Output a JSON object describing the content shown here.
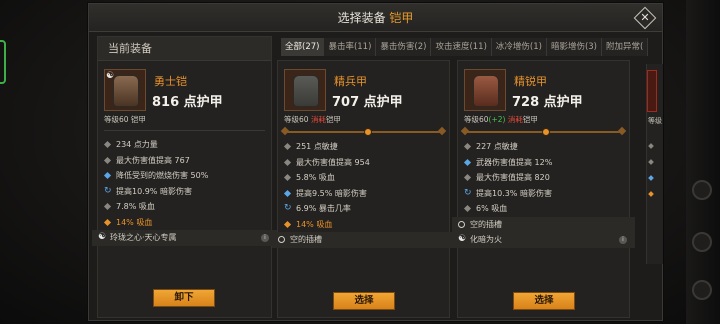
{
  "header": {
    "title_prefix": "选择装备",
    "title_highlight": "铠甲"
  },
  "current": {
    "section_title": "当前装备",
    "item": {
      "name": "勇士铠",
      "armor": "816 点护甲",
      "level_text": "等级60 铠甲",
      "stats": [
        {
          "icon": "diamond-gray",
          "text": "234 点力量"
        },
        {
          "icon": "diamond-gray",
          "text": "最大伤害值提高 767"
        },
        {
          "icon": "diamond-blue",
          "text": "降低受到的燃烧伤害 50%"
        },
        {
          "icon": "cycle-blue",
          "text": "提高10.9% 暗影伤害"
        },
        {
          "icon": "diamond-gray",
          "text": "7.8% 吸血"
        },
        {
          "icon": "diamond-orange",
          "text": "14% 吸血"
        }
      ],
      "socket": {
        "icon": "yin-yang",
        "text": "玲珑之心·天心专属"
      },
      "button": "卸下"
    }
  },
  "tabs": [
    "全部(27)",
    "暴击率(11)",
    "暴击伤害(2)",
    "攻击速度(11)",
    "冰冷增伤(1)",
    "暗影增伤(3)",
    "附加异常("
  ],
  "candidates": [
    {
      "name": "精兵甲",
      "armor": "707 点护甲",
      "level_prefix": "等级60",
      "level_red": "消耗",
      "level_suffix": "铠甲",
      "stats": [
        {
          "icon": "diamond-gray",
          "text": "251 点敏捷"
        },
        {
          "icon": "diamond-gray",
          "text": "最大伤害值提高 954"
        },
        {
          "icon": "diamond-gray",
          "text": "5.8% 吸血"
        },
        {
          "icon": "diamond-blue",
          "text": "提高9.5% 暗影伤害"
        },
        {
          "icon": "cycle-blue",
          "text": "6.9% 暴击几率"
        },
        {
          "icon": "diamond-orange",
          "text": "14% 吸血"
        }
      ],
      "socket": {
        "icon": "empty-ring",
        "text": "空的插槽"
      },
      "button": "选择"
    },
    {
      "name": "精锐甲",
      "armor": "728 点护甲",
      "level_prefix": "等级60",
      "level_up": "(+2)",
      "level_red": "消耗",
      "level_suffix": "铠甲",
      "stats": [
        {
          "icon": "diamond-gray",
          "text": "227 点敏捷"
        },
        {
          "icon": "diamond-blue",
          "text": "武器伤害值提高 12%"
        },
        {
          "icon": "diamond-gray",
          "text": "最大伤害值提高 820"
        },
        {
          "icon": "cycle-blue",
          "text": "提高10.3% 暗影伤害"
        },
        {
          "icon": "diamond-gray",
          "text": "6% 吸血"
        }
      ],
      "sockets": [
        {
          "icon": "empty-ring",
          "text": "空的插槽"
        },
        {
          "icon": "yin-yang",
          "text": "化暗为火"
        }
      ],
      "button": "选择"
    }
  ],
  "peek": {
    "level_text": "等级"
  },
  "colors": {
    "accent_orange": "#e8922a",
    "button": "#f0a634",
    "panel": "#1d1c1b",
    "stat_blue": "#5aa6e6"
  }
}
